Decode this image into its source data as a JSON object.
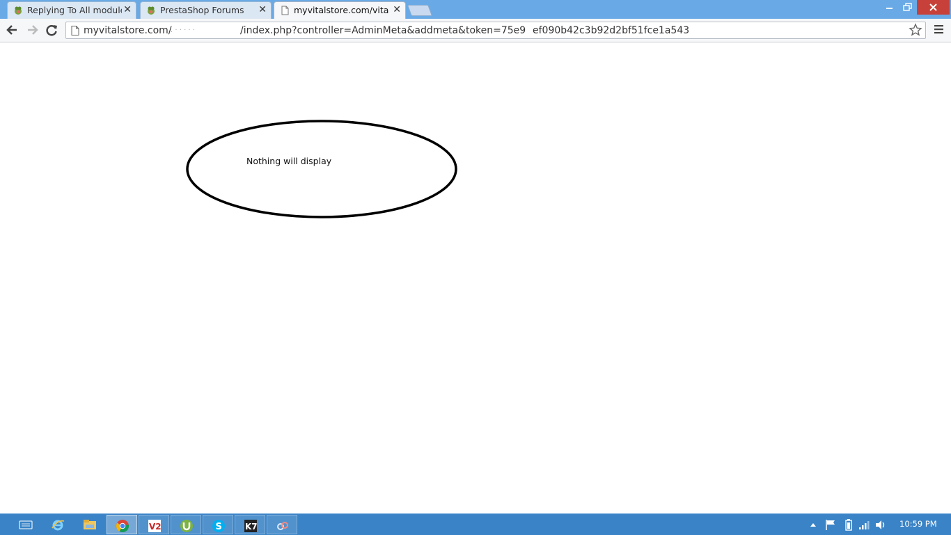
{
  "tabs": [
    {
      "title": "Replying To All modules c",
      "favicon": "prestashop-icon",
      "active": false
    },
    {
      "title": "PrestaShop Forums",
      "favicon": "prestashop-icon",
      "active": false
    },
    {
      "title": "myvitalstore.com/vitaladr",
      "favicon": "page-icon",
      "active": true
    }
  ],
  "address_bar": {
    "url_host": "myvitalstore.com/",
    "url_path": "/index.php?controller=AdminMeta&addmeta&token=75e9",
    "url_token_tail": "ef090b42c3b92d2bf51fce1a543"
  },
  "content": {
    "annotation_text": "Nothing will display"
  },
  "taskbar": {
    "apps": [
      "keyboard-icon",
      "internet-explorer-icon",
      "file-explorer-icon",
      "chrome-icon",
      "v2-app-icon",
      "utorrent-icon",
      "skype-icon",
      "k7-antivirus-icon",
      "network-app-icon"
    ],
    "active_app": "chrome-icon",
    "clock": "10:59 PM"
  },
  "colors": {
    "titlebar": "#69aae6",
    "taskbar": "#3a83c6",
    "close_button": "#c7413a"
  }
}
